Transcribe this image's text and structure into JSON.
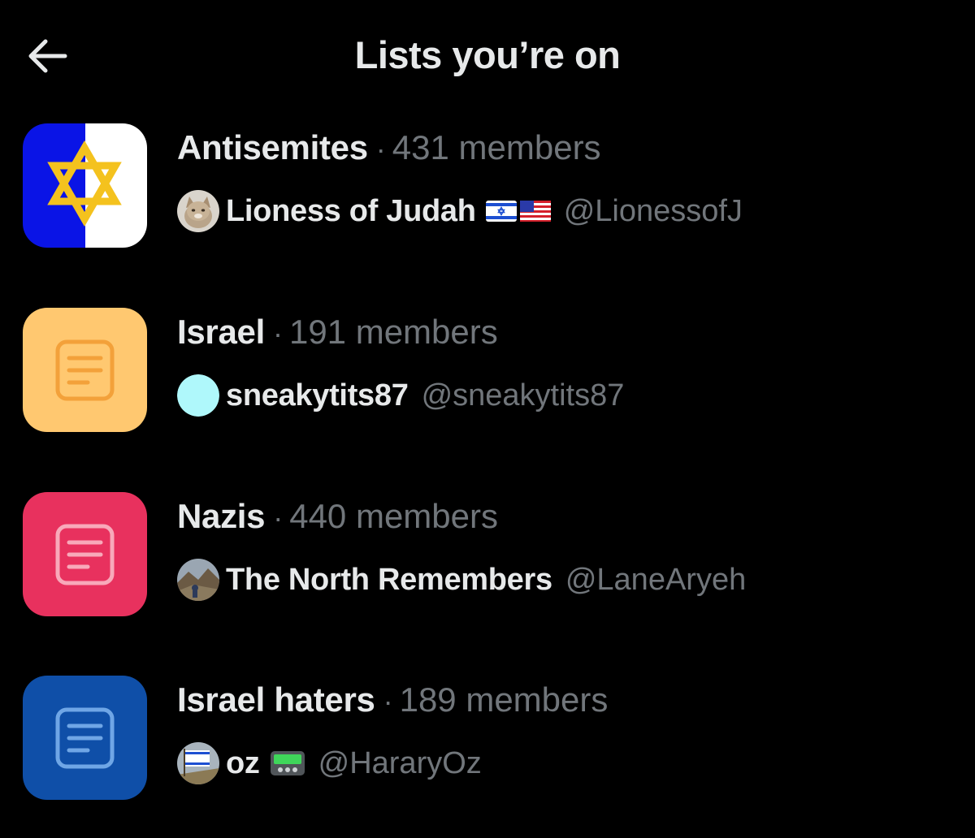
{
  "header": {
    "title": "Lists you’re on",
    "back_icon": "arrow-left-icon"
  },
  "lists": [
    {
      "name": "Antisemites",
      "separator": "·",
      "members": "431 members",
      "icon": "star-of-david-icon",
      "icon_colors": [
        "#0a14e6",
        "#ffffff",
        "#f4c21e"
      ],
      "owner": {
        "name": "Lioness of Judah",
        "handle": "@LionessofJ",
        "emoji": [
          "israel-flag",
          "us-flag"
        ]
      }
    },
    {
      "name": "Israel",
      "separator": "·",
      "members": "191 members",
      "icon": "list-document-icon",
      "icon_colors": [
        "#ffc870",
        "#f3a13a"
      ],
      "owner": {
        "name": "sneakytits87",
        "handle": "@sneakytits87",
        "avatar_color": "#aff8fb"
      }
    },
    {
      "name": "Nazis",
      "separator": "·",
      "members": "440 members",
      "icon": "list-document-icon",
      "icon_colors": [
        "#e8315e",
        "#f8a9ba"
      ],
      "owner": {
        "name": "The North Remembers",
        "handle": "@LaneAryeh"
      }
    },
    {
      "name": "Israel haters",
      "separator": "·",
      "members": "189 members",
      "icon": "list-document-icon",
      "icon_colors": [
        "#0f4fa8",
        "#6fa6e6"
      ],
      "owner": {
        "name": "oz",
        "handle": "@HararyOz",
        "emoji": [
          "pager"
        ]
      }
    }
  ]
}
